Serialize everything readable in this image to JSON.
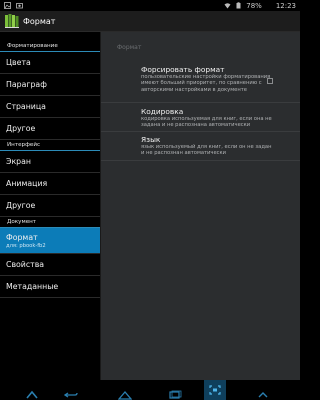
{
  "status_bar": {
    "battery_text": "78%",
    "time": "12:23"
  },
  "action_bar": {
    "title": "Формат"
  },
  "sidebar": {
    "sections": [
      {
        "header": "Форматирование",
        "items": [
          {
            "label": "Цвета"
          },
          {
            "label": "Параграф"
          },
          {
            "label": "Страница"
          },
          {
            "label": "Другое"
          }
        ]
      },
      {
        "header": "Интерфейс",
        "items": [
          {
            "label": "Экран"
          },
          {
            "label": "Анимация"
          },
          {
            "label": "Другое"
          }
        ]
      },
      {
        "header": "Документ",
        "items": [
          {
            "label": "Формат",
            "sublabel": "для: pbook-fb2",
            "selected": true
          },
          {
            "label": "Свойства"
          },
          {
            "label": "Метаданные"
          }
        ]
      }
    ]
  },
  "content": {
    "header": "Формат",
    "prefs": [
      {
        "title": "Форсировать формат",
        "summary": "пользовательские настройки форматирования имеют больший приоритет, по сравнению с авторскими настройками в документе",
        "checked": false
      },
      {
        "title": "Кодировка",
        "summary": "кодировка используемая для книг, если она не задана и не распознана автоматически"
      },
      {
        "title": "Язык",
        "summary": "язык используемый для книг, если он не задан и не распознан автоматически"
      }
    ]
  },
  "nav_bar": {
    "active": "screenshot"
  },
  "colors": {
    "accent": "#0c7cb8",
    "content_bg": "#2b2d2f",
    "divider": "#2c8bb8"
  }
}
